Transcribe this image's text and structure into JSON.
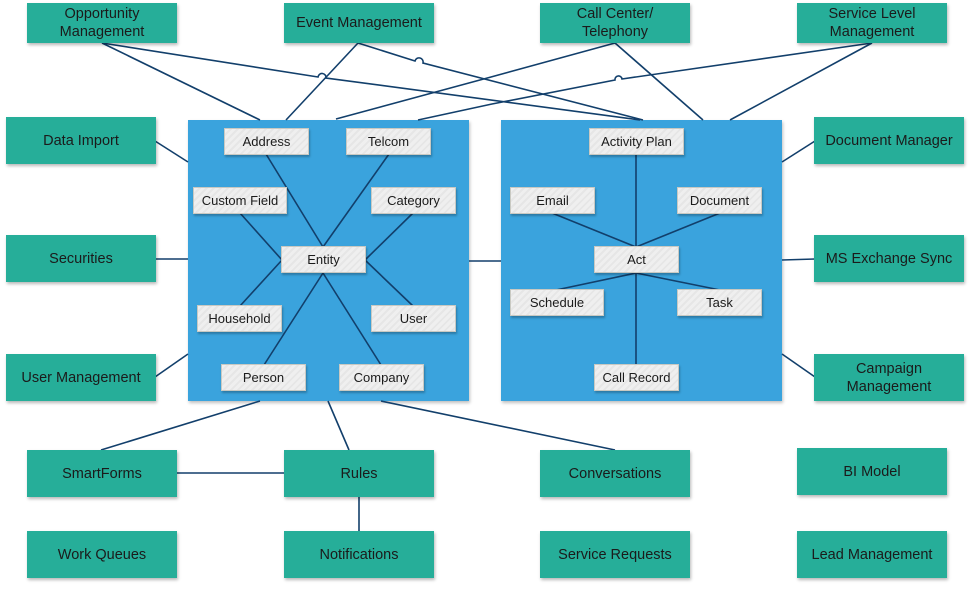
{
  "diagram": {
    "modules": {
      "opportunity_management": "Opportunity\nManagement",
      "event_management": "Event Management",
      "call_center": "Call Center/\nTelephony",
      "service_level_management": "Service Level\nManagement",
      "data_import": "Data Import",
      "securities": "Securities",
      "user_management": "User Management",
      "document_manager": "Document Manager",
      "ms_exchange_sync": "MS Exchange Sync",
      "campaign_management": "Campaign\nManagement",
      "smartforms": "SmartForms",
      "rules": "Rules",
      "conversations": "Conversations",
      "bi_model": "BI Model",
      "work_queues": "Work Queues",
      "notifications": "Notifications",
      "service_requests": "Service Requests",
      "lead_management": "Lead Management"
    },
    "entity_group": {
      "center": "Entity",
      "address": "Address",
      "telcom": "Telcom",
      "custom_field": "Custom Field",
      "category": "Category",
      "household": "Household",
      "user": "User",
      "person": "Person",
      "company": "Company"
    },
    "activity_group": {
      "center": "Act",
      "activity_plan": "Activity Plan",
      "email": "Email",
      "document": "Document",
      "schedule": "Schedule",
      "task": "Task",
      "call_record": "Call Record"
    },
    "colors": {
      "module_fill": "#26ae99",
      "group_fill": "#3aa3dd",
      "entity_fill": "#ececec",
      "connector": "#123f6b"
    }
  }
}
